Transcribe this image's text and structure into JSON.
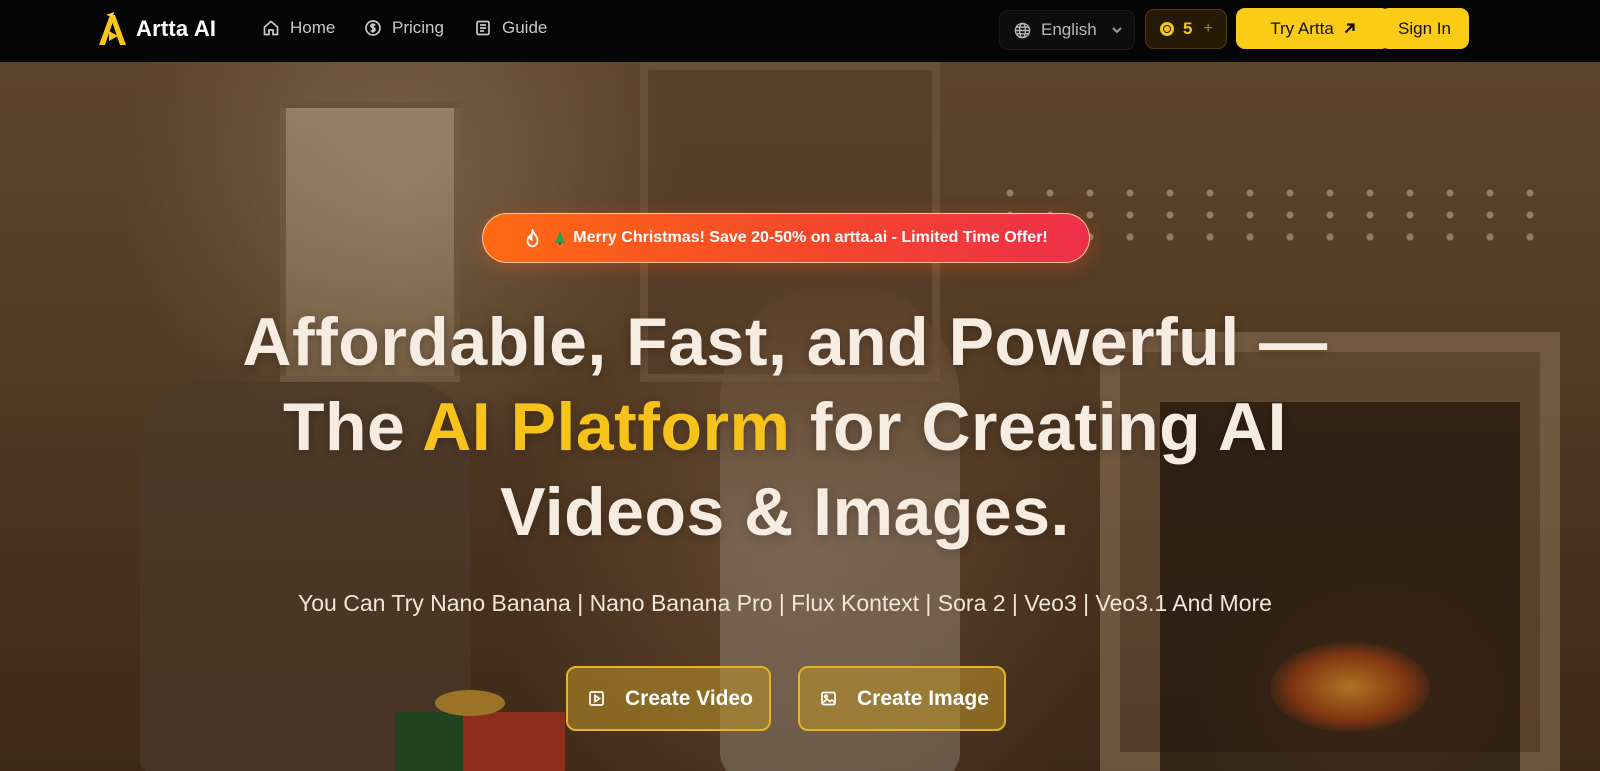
{
  "brand": {
    "name": "Artta AI",
    "logo_icon": "artta-logo-icon",
    "accent_color": "#facc15"
  },
  "nav": {
    "links": [
      {
        "label": "Home",
        "icon": "home-icon"
      },
      {
        "label": "Pricing",
        "icon": "dollar-circle-icon"
      },
      {
        "label": "Guide",
        "icon": "book-icon"
      }
    ],
    "language": {
      "selected": "English",
      "icon": "globe-icon"
    },
    "credits": {
      "count": "5",
      "plus": "+"
    },
    "try_button": "Try Artta",
    "signin_button": "Sign In"
  },
  "hero": {
    "promo": {
      "emoji": "🎄",
      "text": "Merry Christmas! Save 20-50% on artta.ai - Limited Time Offer!",
      "icon": "fire-icon"
    },
    "headline": {
      "line1": "Affordable, Fast, and Powerful —",
      "line2_before": "The ",
      "line2_accent": "AI Platform",
      "line2_after": " for Creating AI",
      "line3": "Videos & Images."
    },
    "subline": "You Can Try Nano Banana | Nano Banana Pro | Flux Kontext | Sora 2 | Veo3 | Veo3.1 And More",
    "cta": {
      "video": {
        "label": "Create Video",
        "icon": "play-square-icon"
      },
      "image": {
        "label": "Create Image",
        "icon": "image-icon"
      }
    }
  }
}
